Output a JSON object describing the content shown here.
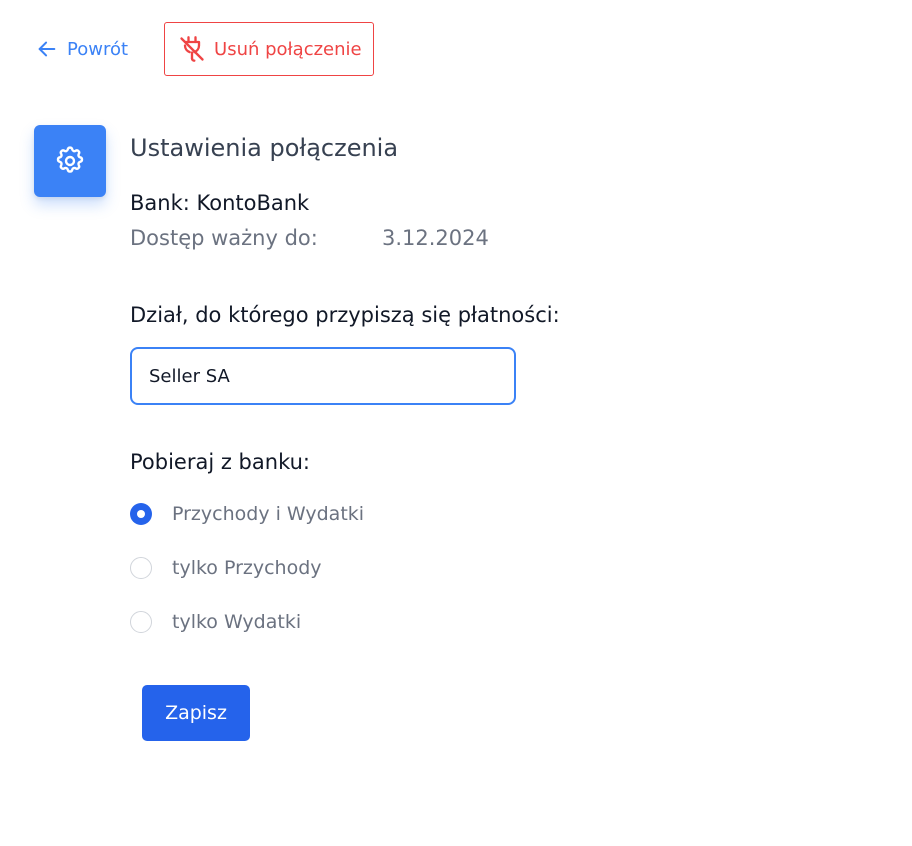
{
  "header": {
    "back_label": "Powrót",
    "disconnect_label": "Usuń połączenie"
  },
  "icons": {
    "back": "arrow-left-icon",
    "disconnect": "unplug-icon",
    "settings": "gear-icon"
  },
  "colors": {
    "accent": "#3b82f6",
    "primary_button": "#2563eb",
    "danger": "#ef4444",
    "muted_text": "#6b7280"
  },
  "settings": {
    "title": "Ustawienia połączenia",
    "bank_line": "Bank: KontoBank",
    "access_label": "Dostęp ważny do:",
    "access_value": "3.12.2024"
  },
  "department": {
    "label": "Dział, do którego przypiszą się płatności:",
    "value": "Seller SA"
  },
  "fetch": {
    "label": "Pobieraj z banku:",
    "options": [
      {
        "label": "Przychody i Wydatki",
        "selected": true
      },
      {
        "label": "tylko Przychody",
        "selected": false
      },
      {
        "label": "tylko Wydatki",
        "selected": false
      }
    ]
  },
  "actions": {
    "save_label": "Zapisz"
  }
}
